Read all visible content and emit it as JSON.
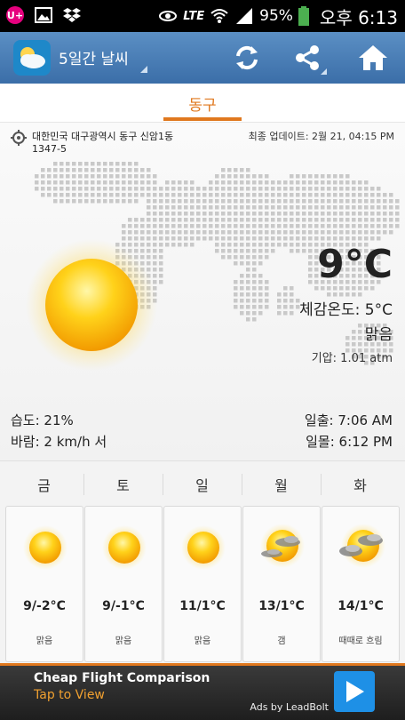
{
  "status_bar": {
    "battery": "95%",
    "time": "오후 6:13",
    "lte": "LTE"
  },
  "app_bar": {
    "title": "5일간 날씨"
  },
  "location_tab": {
    "label": "동구"
  },
  "current": {
    "address_line1": "대한민국 대구광역시 동구 신암1동",
    "address_line2": "1347-5",
    "last_update": "최종 업데이트: 2월 21, 04:15 PM",
    "temperature": "9°C",
    "feels_like": "체감온도: 5°C",
    "condition": "맑음",
    "pressure": "기압: 1.01 atm",
    "humidity": "습도: 21%",
    "wind": "바람: 2 km/h 서",
    "sunrise": "일출: 7:06 AM",
    "sunset": "일몰: 6:12 PM"
  },
  "forecast": [
    {
      "day": "금",
      "temp": "9/-2°C",
      "condition": "맑음",
      "icon": "sun-icon"
    },
    {
      "day": "토",
      "temp": "9/-1°C",
      "condition": "맑음",
      "icon": "sun-icon"
    },
    {
      "day": "일",
      "temp": "11/1°C",
      "condition": "맑음",
      "icon": "sun-icon"
    },
    {
      "day": "월",
      "temp": "13/1°C",
      "condition": "갬",
      "icon": "sun-cloud-icon"
    },
    {
      "day": "화",
      "temp": "14/1°C",
      "condition": "때때로 흐림",
      "icon": "sun-cloud-icon"
    }
  ],
  "ad": {
    "title": "Cheap Flight Comparison",
    "subtitle": "Tap to View",
    "attribution": "Ads by LeadBolt"
  },
  "colors": {
    "accent": "#e0781e",
    "app_bar": "#4a7fb8",
    "ad_button": "#1e90e6"
  }
}
